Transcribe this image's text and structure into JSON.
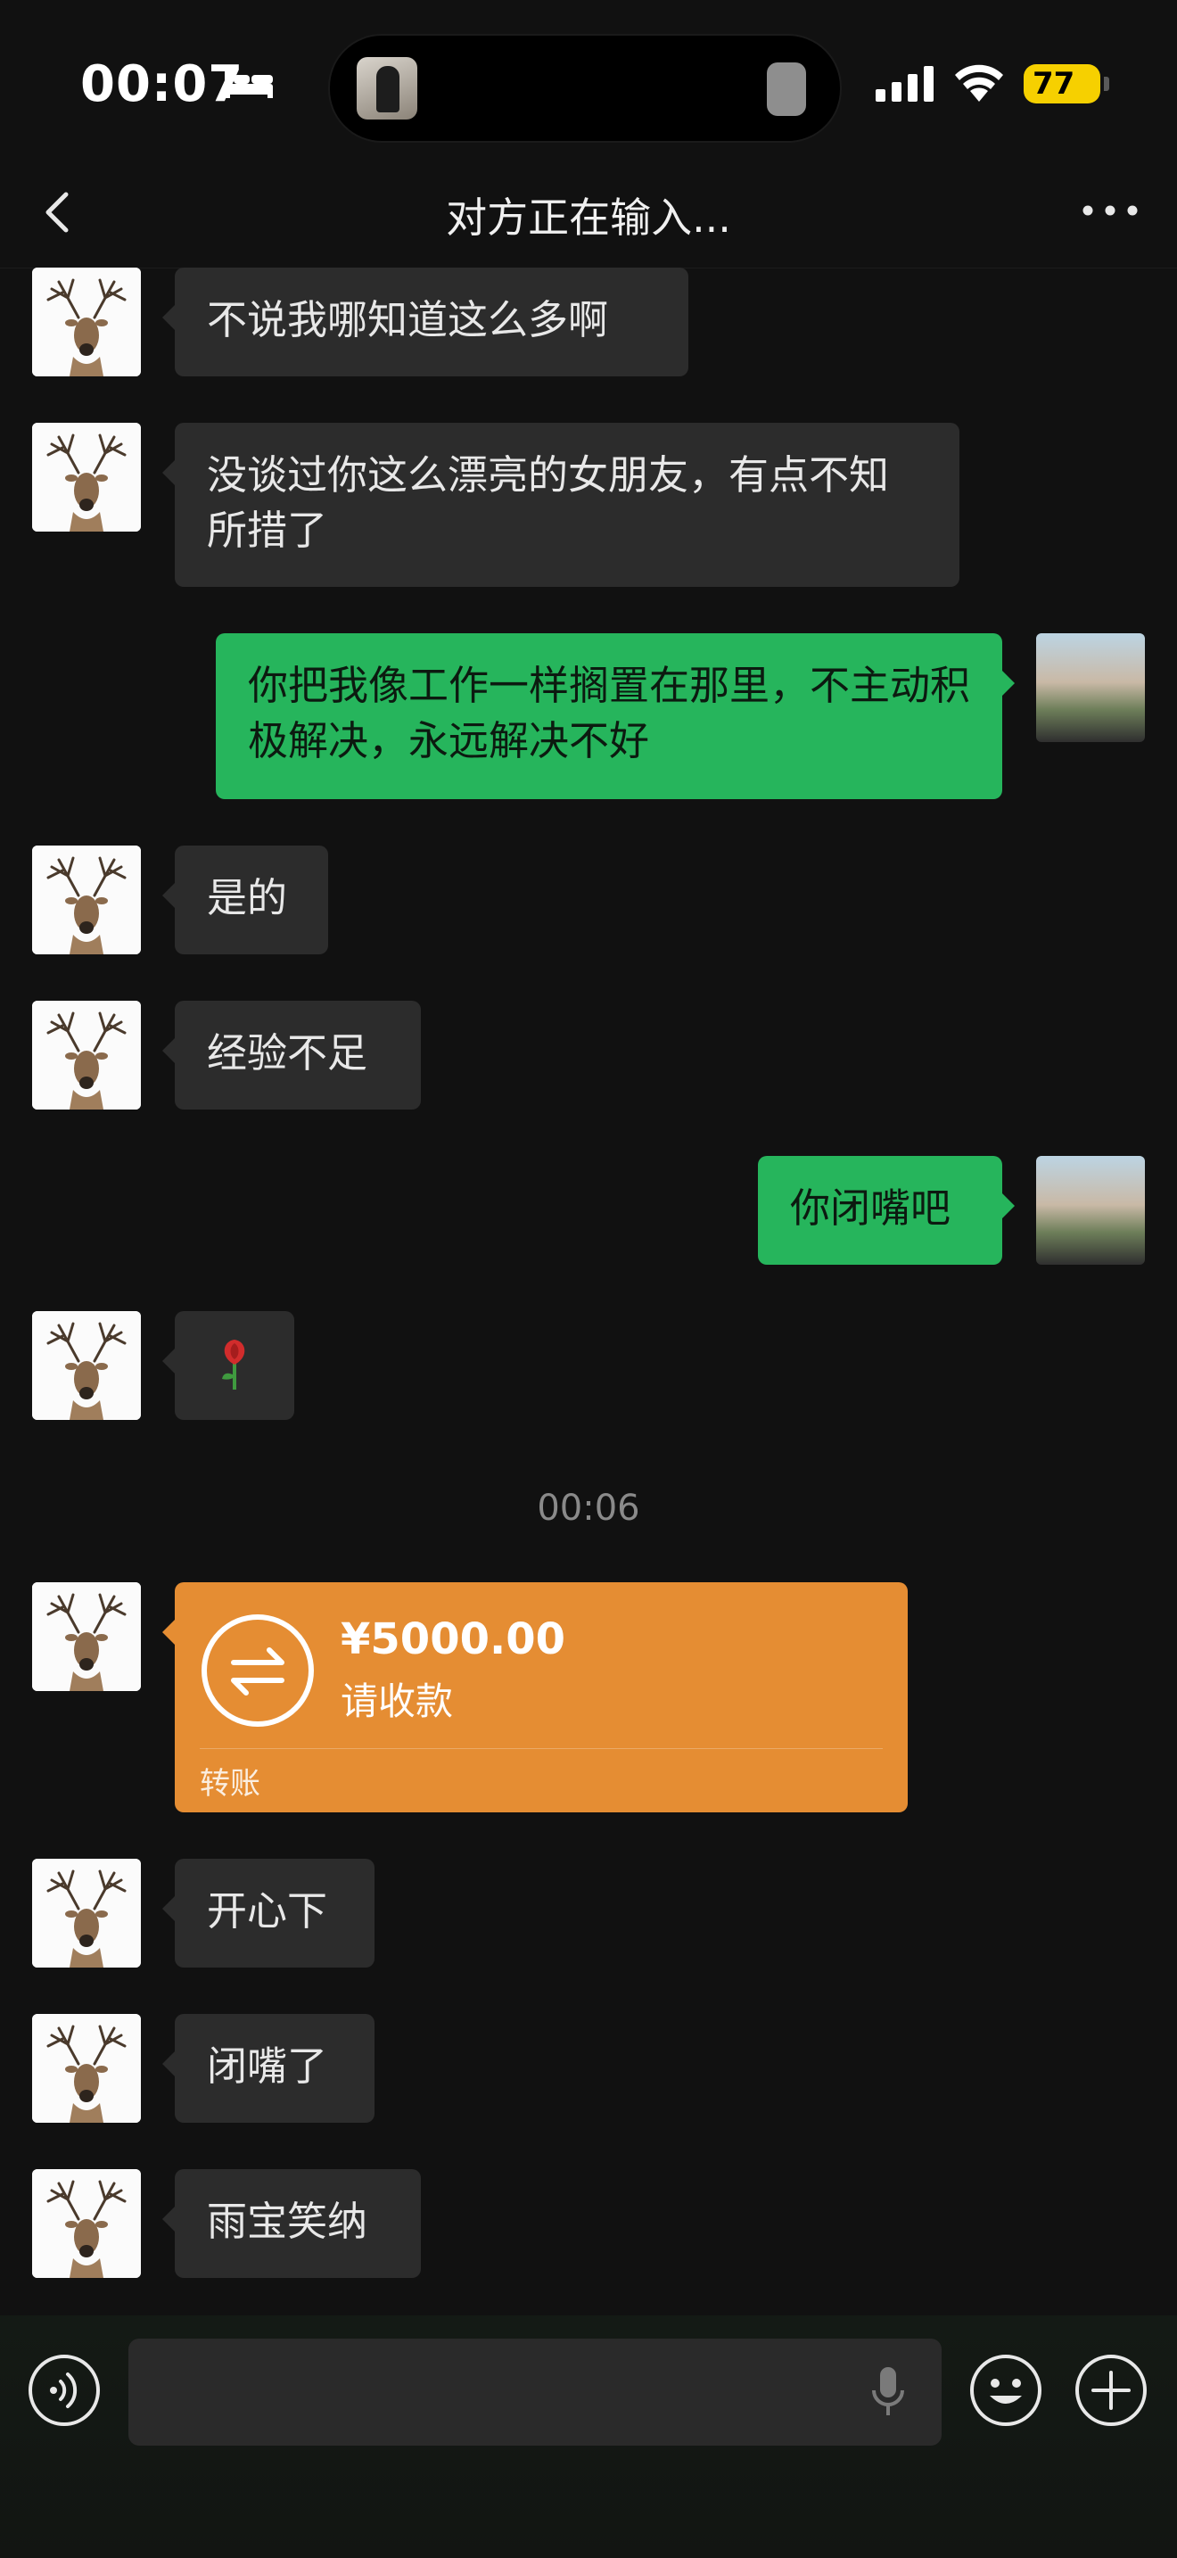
{
  "status_bar": {
    "time": "00:07",
    "battery": "77"
  },
  "nav": {
    "title": "对方正在输入..."
  },
  "messages": [
    {
      "text": "不说我哪知道这么多啊"
    },
    {
      "text": "没谈过你这么漂亮的女朋友，有点不知所措了"
    },
    {
      "text": "你把我像工作一样搁置在那里，不主动积极解决，永远解决不好"
    },
    {
      "text": "是的"
    },
    {
      "text": "经验不足"
    },
    {
      "text": "你闭嘴吧"
    },
    {
      "text": "🌹"
    },
    {
      "text": "开心下"
    },
    {
      "text": "闭嘴了"
    },
    {
      "text": "雨宝笑纳"
    }
  ],
  "timestamp": "00:06",
  "transfer": {
    "amount": "¥5000.00",
    "desc": "请收款",
    "label": "转账"
  },
  "colors": {
    "incoming": "#2c2c2c",
    "outgoing": "#26b55c",
    "transfer": "#e58d33",
    "background": "#111111"
  },
  "icons": [
    "back-icon",
    "more-icon",
    "voice-icon",
    "mic-icon",
    "emoji-icon",
    "plus-icon",
    "transfer-icon"
  ]
}
